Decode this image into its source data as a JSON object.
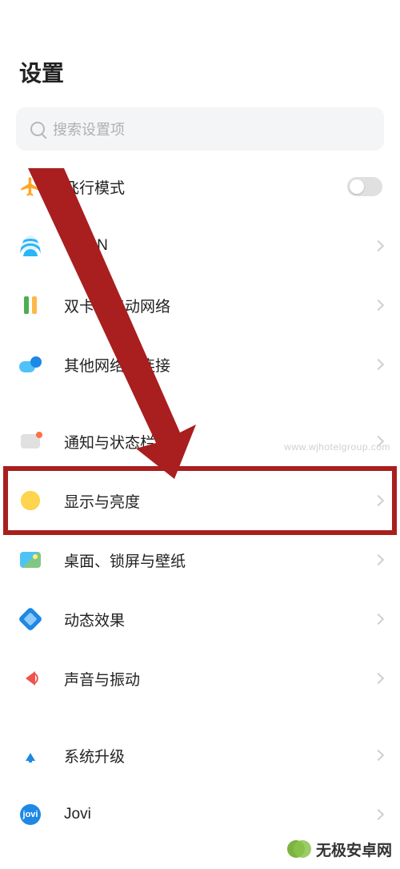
{
  "page": {
    "title": "设置"
  },
  "search": {
    "placeholder": "搜索设置项"
  },
  "groups": [
    {
      "rows": [
        {
          "key": "airplane",
          "label": "飞行模式",
          "accessory": "toggle",
          "toggle_on": false
        },
        {
          "key": "wlan",
          "label": "WLAN",
          "accessory": "chevron"
        },
        {
          "key": "sim",
          "label": "双卡与移动网络",
          "accessory": "chevron"
        },
        {
          "key": "other-net",
          "label": "其他网络与连接",
          "accessory": "chevron"
        }
      ]
    },
    {
      "rows": [
        {
          "key": "notif",
          "label": "通知与状态栏",
          "accessory": "chevron"
        },
        {
          "key": "display",
          "label": "显示与亮度",
          "accessory": "chevron",
          "highlighted": true
        },
        {
          "key": "wallpaper",
          "label": "桌面、锁屏与壁纸",
          "accessory": "chevron"
        },
        {
          "key": "motion",
          "label": "动态效果",
          "accessory": "chevron"
        },
        {
          "key": "sound",
          "label": "声音与振动",
          "accessory": "chevron"
        }
      ]
    },
    {
      "rows": [
        {
          "key": "upgrade",
          "label": "系统升级",
          "accessory": "chevron"
        },
        {
          "key": "jovi",
          "label": "Jovi",
          "accessory": "chevron"
        }
      ]
    }
  ],
  "annotation": {
    "arrow_color": "#a91e1e",
    "highlight_target": "display"
  },
  "watermark": {
    "text": "无极安卓网",
    "url": "www.wjhotelgroup.com"
  },
  "icons": {
    "airplane": "airplane-icon",
    "wlan": "wifi-icon",
    "sim": "sim-icon",
    "other-net": "link-icon",
    "notif": "notification-icon",
    "display": "brightness-icon",
    "wallpaper": "wallpaper-icon",
    "motion": "motion-icon",
    "sound": "sound-icon",
    "upgrade": "upgrade-icon",
    "jovi": "jovi-icon"
  }
}
